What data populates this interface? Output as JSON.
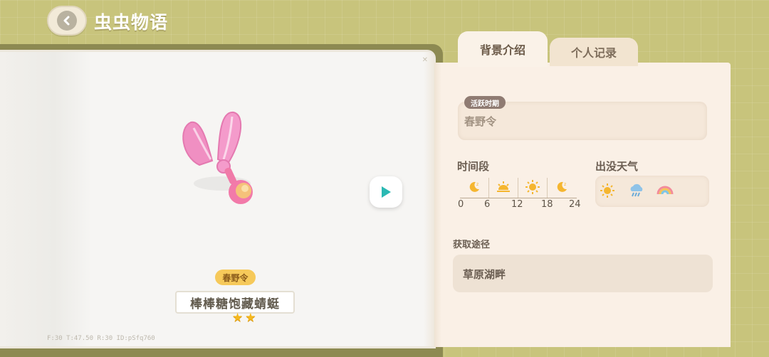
{
  "header": {
    "title": "虫虫物语",
    "back_icon": "back-arrow-icon"
  },
  "book": {
    "season_badge": "春野令",
    "bug_name": "棒棒糖饱藏蜻蜓",
    "stars": 2,
    "debug_text": "F:30  T:47.50  R:30  ID:pSfq760",
    "play_icon": "play-icon"
  },
  "tabs": [
    {
      "label": "背景介绍",
      "active": true
    },
    {
      "label": "个人记录",
      "active": false
    }
  ],
  "panel": {
    "active_period": {
      "label": "活跃时期",
      "value": "春野令"
    },
    "time_section": {
      "title": "时间段",
      "slots": [
        {
          "icon": "moon-icon"
        },
        {
          "icon": "sunrise-icon"
        },
        {
          "icon": "sun-icon"
        },
        {
          "icon": "moon-icon"
        }
      ],
      "ticks": [
        "0",
        "6",
        "12",
        "18",
        "24"
      ]
    },
    "weather_section": {
      "title": "出没天气",
      "icons": [
        "sun-icon",
        "rain-cloud-icon",
        "rainbow-icon"
      ]
    },
    "route_section": {
      "title": "获取途径",
      "value": "草原湖畔"
    }
  },
  "colors": {
    "background": "#c8c47c",
    "panel": "#faf0e6",
    "star": "#f5b81e",
    "badge": "#f6c95a",
    "play": "#2bb9b3"
  }
}
